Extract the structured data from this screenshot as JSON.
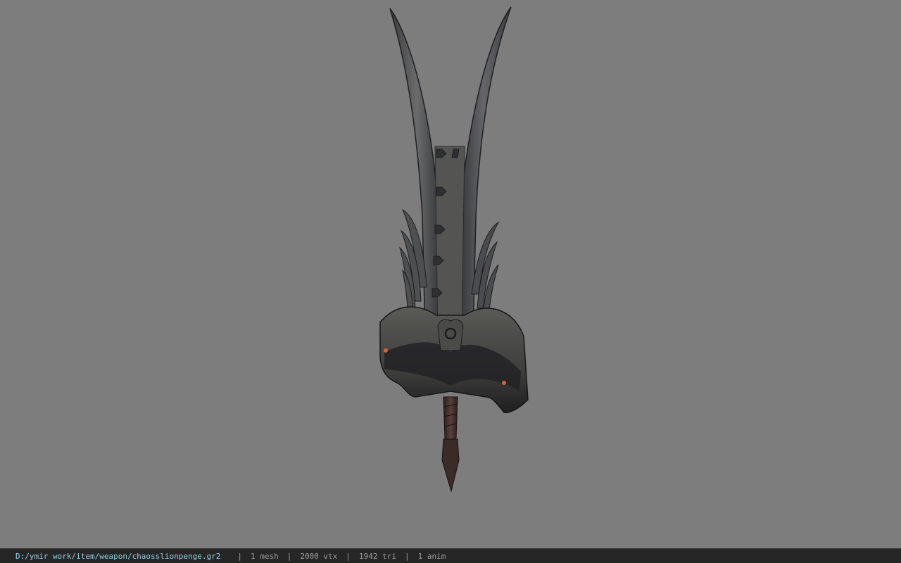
{
  "viewer": {
    "background": "#7d7d7d",
    "model_icon": "weapon-3d-model"
  },
  "statusbar": {
    "file_path": "D:/ymir work/item/weapon/chaosslionpenge.gr2",
    "separator": "|",
    "meshes": "1 mesh",
    "vertices": "2000 vtx",
    "triangles": "1942 tri",
    "animations": "1 anim",
    "path_color": "#8fd0e6"
  }
}
